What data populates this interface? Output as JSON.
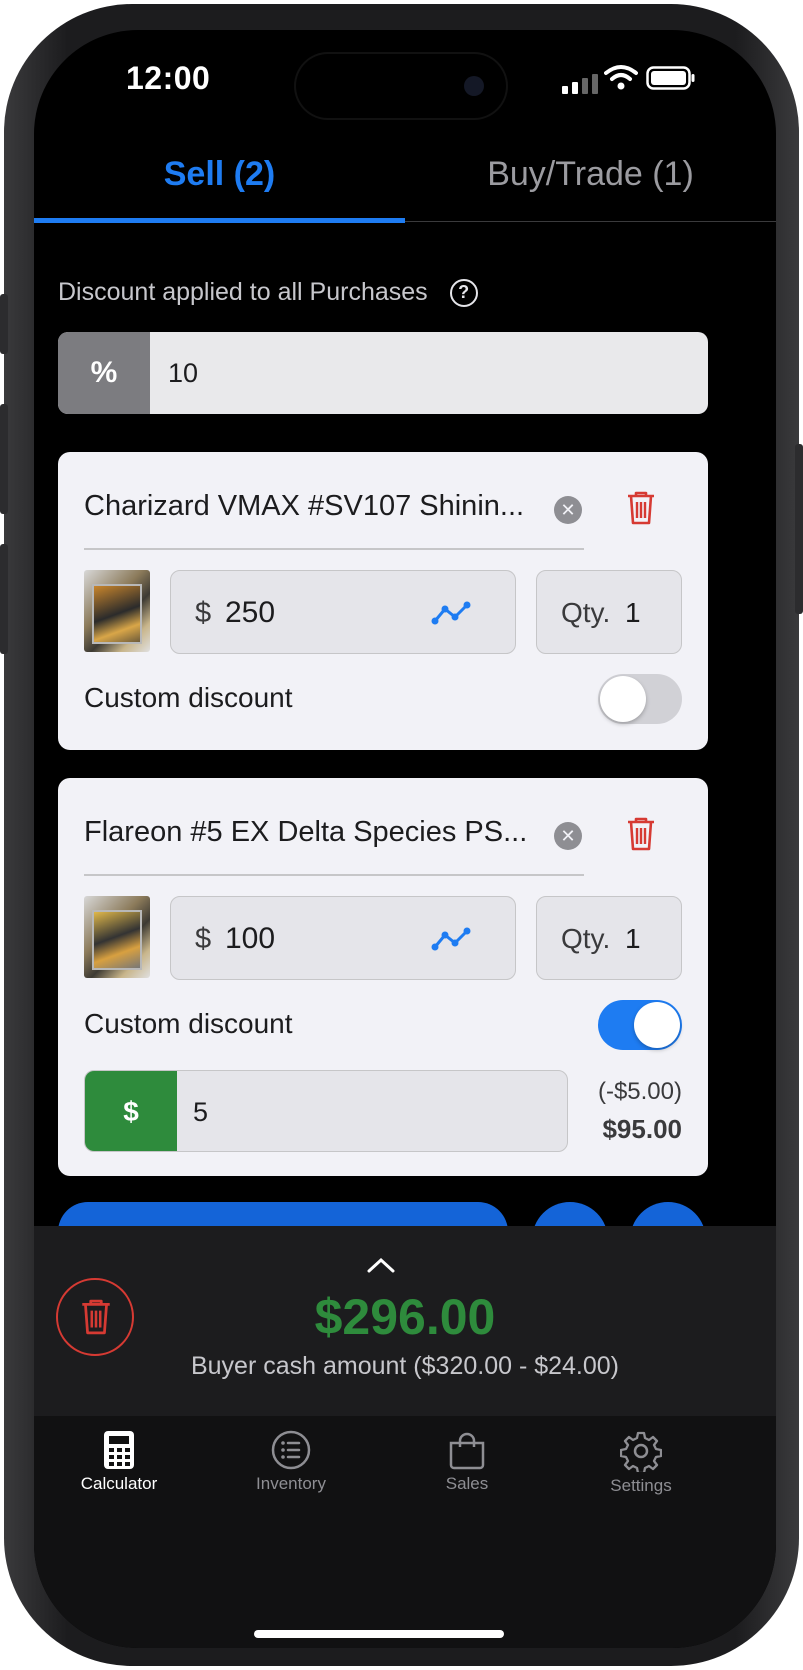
{
  "status_bar": {
    "time": "12:00"
  },
  "tabs": [
    {
      "label": "Sell (2)",
      "active": true
    },
    {
      "label": "Buy/Trade (1)",
      "active": false
    }
  ],
  "discount": {
    "label": "Discount applied to all Purchases",
    "prefix": "%",
    "value": "10"
  },
  "items": [
    {
      "title": "Charizard VMAX #SV107 Shinin...",
      "currency": "$",
      "price": "250",
      "qty_label": "Qty.",
      "qty": "1",
      "custom_discount_label": "Custom discount",
      "custom_discount_on": false
    },
    {
      "title": "Flareon #5 EX Delta Species PS...",
      "currency": "$",
      "price": "100",
      "qty_label": "Qty.",
      "qty": "1",
      "custom_discount_label": "Custom discount",
      "custom_discount_on": true,
      "custom_discount_prefix": "$",
      "custom_discount_value": "5",
      "discount_delta": "(-$5.00)",
      "discounted_price": "$95.00"
    }
  ],
  "summary": {
    "total": "$296.00",
    "description": "Buyer cash amount  ($320.00 - $24.00)"
  },
  "nav": [
    {
      "label": "Calculator",
      "icon": "calculator-icon",
      "active": true
    },
    {
      "label": "Inventory",
      "icon": "list-icon",
      "active": false
    },
    {
      "label": "Sales",
      "icon": "shopping-bag-icon",
      "active": false
    },
    {
      "label": "Settings",
      "icon": "gear-icon",
      "active": false
    }
  ],
  "colors": {
    "accent": "#1e7cf2",
    "positive": "#2e8b3c",
    "danger": "#d63a33"
  }
}
